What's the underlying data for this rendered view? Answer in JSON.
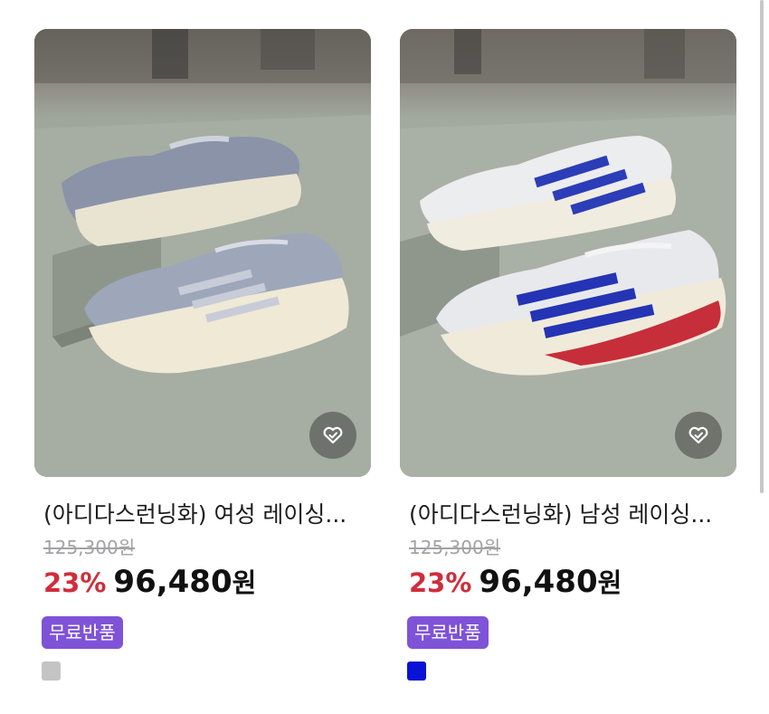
{
  "products": [
    {
      "title": "(아디다스런닝화) 여성 레이싱...",
      "original_price": "125,300원",
      "discount": "23%",
      "price": "96,480",
      "currency": "원",
      "badge": "무료반품",
      "color_swatch": "#c4c4c4",
      "wishlist_icon": "heart-icon"
    },
    {
      "title": "(아디다스런닝화) 남성 레이싱...",
      "original_price": "125,300원",
      "discount": "23%",
      "price": "96,480",
      "currency": "원",
      "badge": "무료반품",
      "color_swatch": "#0a12d6",
      "wishlist_icon": "heart-icon"
    }
  ],
  "colors": {
    "discount": "#d12d3b",
    "badge": "#7e53d8"
  }
}
